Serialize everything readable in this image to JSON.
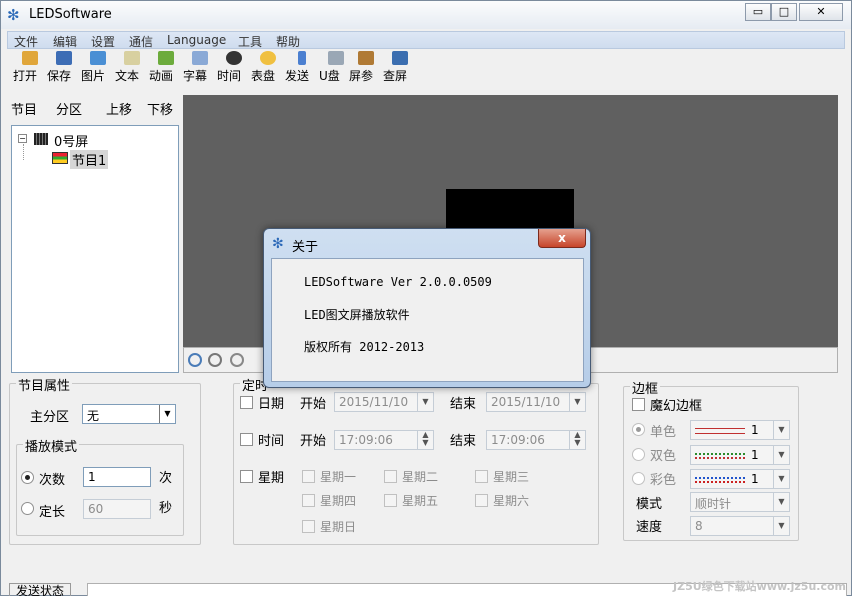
{
  "window": {
    "title": "LEDSoftware",
    "buttons": {
      "minimize": "▭",
      "maximize": "□",
      "close": "✕"
    }
  },
  "menu": [
    "文件",
    "编辑",
    "设置",
    "通信",
    "Language",
    "工具",
    "帮助"
  ],
  "toolbar": [
    {
      "label": "打开",
      "icon": "open-folder-icon",
      "color": "#e0a63a"
    },
    {
      "label": "保存",
      "icon": "save-disk-icon",
      "color": "#3d6db5"
    },
    {
      "label": "图片",
      "icon": "picture-icon",
      "color": "#4a8fd4"
    },
    {
      "label": "文本",
      "icon": "text-edit-icon",
      "color": "#d8d0a0"
    },
    {
      "label": "动画",
      "icon": "animation-icon",
      "color": "#6cab3c"
    },
    {
      "label": "字幕",
      "icon": "subtitle-icon",
      "color": "#8aa9d6"
    },
    {
      "label": "时间",
      "icon": "clock-icon",
      "color": "#333333"
    },
    {
      "label": "表盘",
      "icon": "dial-icon",
      "color": "#f0c040"
    },
    {
      "label": "发送",
      "icon": "send-icon",
      "color": "#4b7fd0"
    },
    {
      "label": "U盘",
      "icon": "usb-icon",
      "color": "#9aa7b5"
    },
    {
      "label": "屏参",
      "icon": "screen-params-icon",
      "color": "#b07a35"
    },
    {
      "label": "查屏",
      "icon": "find-screen-icon",
      "color": "#3b6eb0"
    }
  ],
  "tabs": [
    "节目",
    "分区",
    "上移",
    "下移"
  ],
  "tree": {
    "root": "0号屏",
    "child": "节目1"
  },
  "program_props": {
    "title": "节目属性",
    "main_area_label": "主分区",
    "main_area_value": "无",
    "play_mode_title": "播放模式",
    "count_label": "次数",
    "count_value": "1",
    "count_unit": "次",
    "duration_label": "定长",
    "duration_value": "60",
    "duration_unit": "秒"
  },
  "timing": {
    "title": "定时",
    "date_label": "日期",
    "time_label": "时间",
    "week_label": "星期",
    "start_label": "开始",
    "end_label": "结束",
    "date_start": "2015/11/10",
    "date_end": "2015/11/10",
    "time_start": "17:09:06",
    "time_end": "17:09:06",
    "weekdays": [
      "星期一",
      "星期二",
      "星期三",
      "星期四",
      "星期五",
      "星期六",
      "星期日"
    ]
  },
  "border": {
    "title": "边框",
    "fancy_label": "魔幻边框",
    "single_label": "单色",
    "double_label": "双色",
    "color_label": "彩色",
    "single_value": "1",
    "double_value": "1",
    "color_value": "1",
    "mode_label": "模式",
    "mode_value": "顺时针",
    "speed_label": "速度",
    "speed_value": "8"
  },
  "status": {
    "send_status_label": "发送状态"
  },
  "about": {
    "title": "关于",
    "close": "x",
    "version": "LEDSoftware Ver 2.0.0.0509",
    "product": "LED图文屏播放软件",
    "copyright": "版权所有 2012-2013"
  },
  "watermark": "JZ5U绿色下载站www.jz5u.com"
}
